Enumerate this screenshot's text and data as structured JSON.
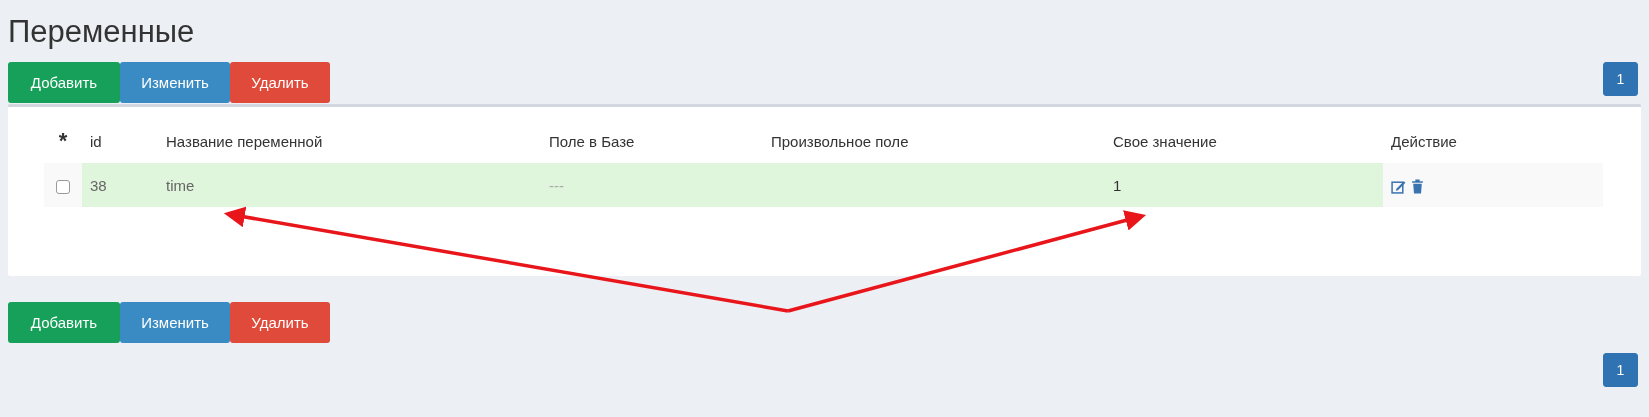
{
  "title": "Переменные",
  "toolbar_top": {
    "buttons": [
      {
        "label": "Добавить",
        "kind": "add"
      },
      {
        "label": "Изменить",
        "kind": "edit"
      },
      {
        "label": "Удалить",
        "kind": "delete"
      }
    ],
    "pages": [
      {
        "label": "1",
        "selected": true
      }
    ]
  },
  "table": {
    "columns": [
      "*",
      "id",
      "Название переменной",
      "Поле в Базе",
      "Произвольное поле",
      "Свое значение",
      "Действие"
    ],
    "rows": [
      {
        "checked": false,
        "highlighted": true,
        "id": "38",
        "name": "time",
        "db_field": "---",
        "custom_field": "",
        "value": "1"
      }
    ]
  },
  "toolbar_bottom": {
    "buttons": [
      {
        "label": "Добавить",
        "kind": "add"
      },
      {
        "label": "Изменить",
        "kind": "edit"
      },
      {
        "label": "Удалить",
        "kind": "delete"
      }
    ],
    "pages": [
      {
        "label": "1",
        "selected": true
      }
    ]
  }
}
